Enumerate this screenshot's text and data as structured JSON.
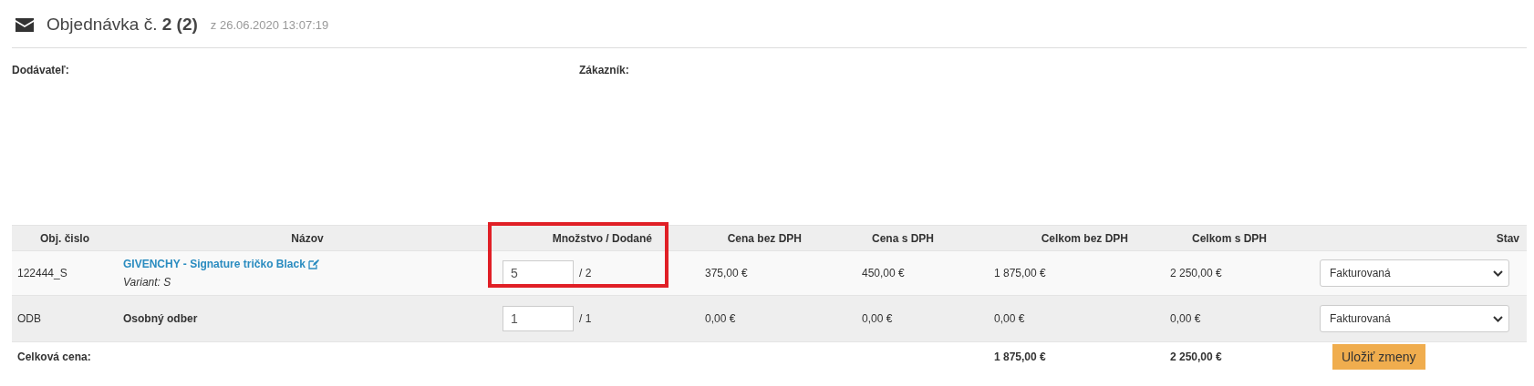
{
  "header": {
    "title": "Objednávka č.",
    "number": "2 (2)",
    "date": "z 26.06.2020 13:07:19"
  },
  "parties": [
    {
      "label": "Dodávateľ:"
    },
    {
      "label": "Zákazník:"
    }
  ],
  "table": {
    "columns": [
      "Obj. čislo",
      "Názov",
      "Množstvo / Dodané",
      "Cena bez DPH",
      "Cena s DPH",
      "Celkom bez DPH",
      "Celkom s DPH",
      "Stav"
    ],
    "rows": [
      {
        "kind": "product",
        "code": "122444_S",
        "name": "GIVENCHY - Signature tričko Black",
        "variant": "Variant: S",
        "quantity": "5",
        "delivered": "/ 2",
        "price_net": "375,00 €",
        "price_gross": "450,00 €",
        "total_net": "1 875,00 €",
        "total_gross": "2 250,00 €",
        "status": "Fakturovaná"
      },
      {
        "kind": "service",
        "code": "ODB",
        "name": "Osobný odber",
        "quantity": "1",
        "delivered": "/ 1",
        "price_net": "0,00 €",
        "price_gross": "0,00 €",
        "total_net": "0,00 €",
        "total_gross": "0,00 €",
        "status": "Fakturovaná"
      }
    ],
    "footer": {
      "label": "Celková cena:",
      "total_net": "1 875,00 €",
      "total_gross": "2 250,00 €",
      "save_button": "Uložiť zmeny"
    }
  },
  "highlight": true
}
